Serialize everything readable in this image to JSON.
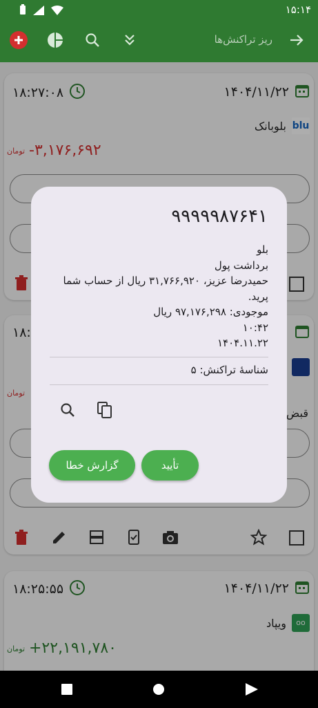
{
  "status": {
    "time": "۱۵:۱۴"
  },
  "appbar": {
    "title": "ریز تراکنش‌ها",
    "icons": [
      "add-icon",
      "pie-chart-icon",
      "search-icon",
      "double-chevron-down-icon",
      "arrow-forward-icon"
    ]
  },
  "cards": [
    {
      "date": "۱۴۰۴/۱۱/۲۲",
      "time": "۱۸:۲۷:۰۸",
      "bank": "بلوبانک",
      "bank_logo": "blu",
      "amount": "-۳,۱۷۶,۶۹۲",
      "unit": "تومان"
    },
    {
      "date": "",
      "time": "۱۸:۱",
      "bank": "",
      "bank_logo": "",
      "amount": "",
      "unit": "تومان",
      "category": "قبض"
    },
    {
      "date": "۱۴۰۴/۱۱/۲۲",
      "time": "۱۸:۲۵:۵۵",
      "bank": "ویپاد",
      "bank_logo": "oo",
      "amount": "+۲۲,۱۹۱,۷۸۰",
      "unit": "تومان"
    }
  ],
  "dialog": {
    "title": "۹۹۹۹۹۸۷۶۴۱",
    "body": "بلو\nبرداشت پول\nحمیدرضا عزیز، ۳۱,۷۶۶,۹۲۰ ریال از حساب شما پرید.\nموجودی: ۹۷,۱۷۶,۲۹۸ ریال\n۱۰:۴۲\n۱۴۰۴.۱۱.۲۲",
    "transaction_id": "شناسهٔ تراکنش: ۵",
    "confirm_label": "تأیید",
    "report_label": "گزارش خطا"
  },
  "colors": {
    "primary": "#2f7a31",
    "button": "#4caf50",
    "negative": "#d32f2f",
    "positive": "#2e7d32",
    "dialog_bg": "#ece8f1"
  }
}
